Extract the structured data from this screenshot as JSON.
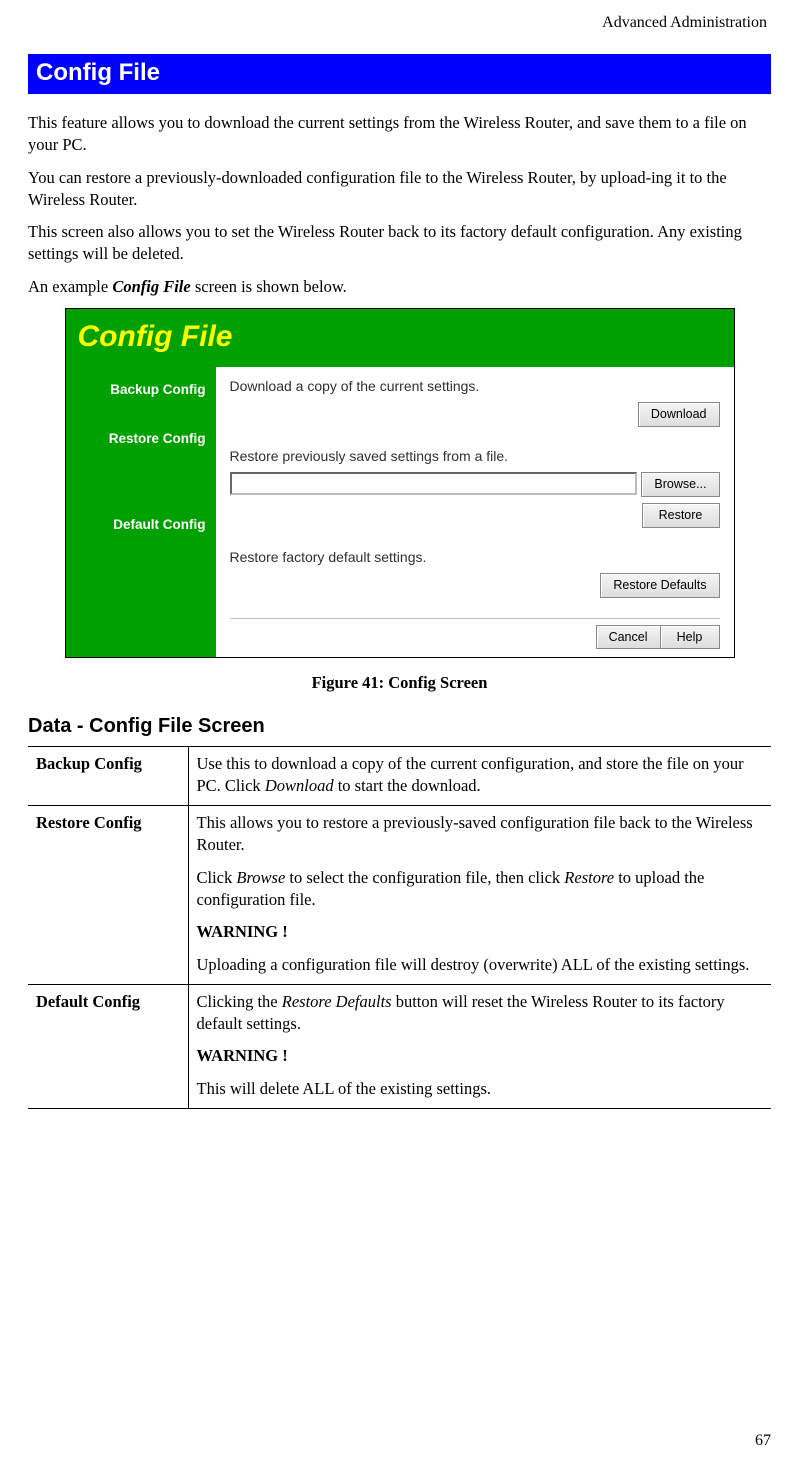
{
  "header": {
    "category": "Advanced Administration"
  },
  "banner": {
    "title": "Config File"
  },
  "paras": {
    "p1": "This feature allows you to download the current settings from the Wireless Router, and save them to a file on your PC.",
    "p2": "You can restore a previously-downloaded configuration file to the Wireless Router, by upload-ing it to the Wireless Router.",
    "p3": "This screen also allows you to set the Wireless Router back to its factory default configuration. Any existing settings will be deleted.",
    "p4_pre": "An example ",
    "p4_em": "Config File",
    "p4_post": " screen is shown below."
  },
  "shot": {
    "title": "Config File",
    "side": {
      "backup": "Backup Config",
      "restore": "Restore Config",
      "default": "Default Config"
    },
    "backup_desc": "Download a copy of the current settings.",
    "download_btn": "Download",
    "restore_desc": "Restore previously saved settings from a file.",
    "browse_btn": "Browse...",
    "restore_btn": "Restore",
    "default_desc": "Restore factory default settings.",
    "restoredef_btn": "Restore Defaults",
    "cancel_btn": "Cancel",
    "help_btn": "Help"
  },
  "caption": "Figure 41: Config Screen",
  "subheading": "Data - Config File Screen",
  "table": {
    "r1": {
      "k": "Backup Config",
      "v_pre": "Use this to download a copy of the current configuration, and store the file on your PC. Click ",
      "v_em": "Download",
      "v_post": " to start the download."
    },
    "r2": {
      "k": "Restore Config",
      "p1": "This allows you to restore a previously-saved configuration file back to the Wireless Router.",
      "p2_pre": "Click ",
      "p2_em1": "Browse",
      "p2_mid": " to select the configuration file, then click ",
      "p2_em2": "Restore",
      "p2_post": " to upload the configuration file.",
      "warn": "WARNING !",
      "p3": "Uploading a configuration file will destroy (overwrite) ALL of the existing settings."
    },
    "r3": {
      "k": "Default Config",
      "p1_pre": "Clicking the ",
      "p1_em": "Restore Defaults",
      "p1_post": " button will reset the Wireless Router to its factory default settings.",
      "warn": "WARNING !",
      "p2": "This will delete ALL of the existing settings."
    }
  },
  "pagenum": "67"
}
